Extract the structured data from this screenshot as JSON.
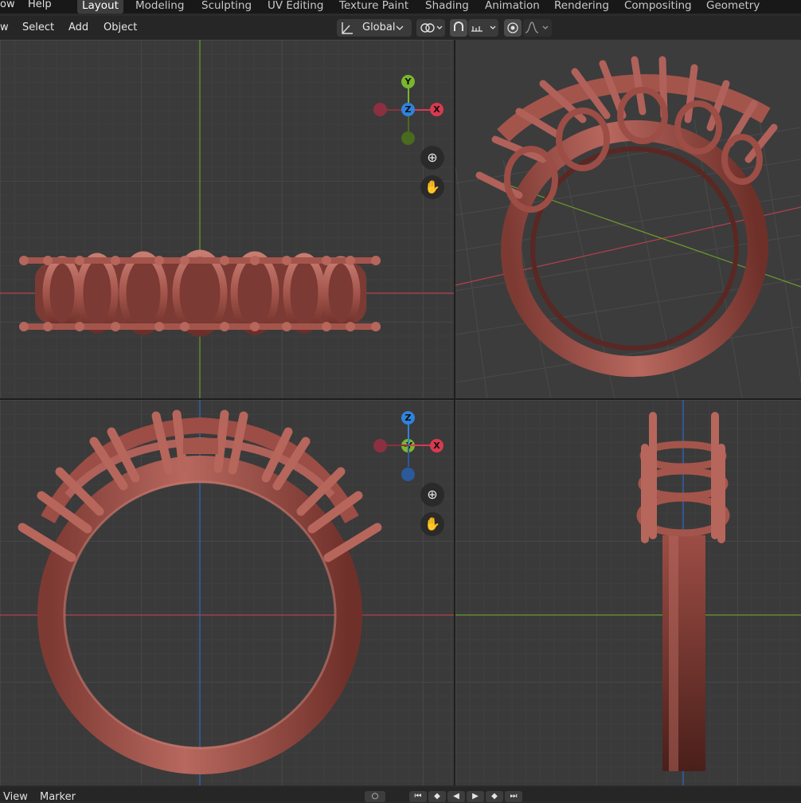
{
  "menubar": {
    "items": [
      "ow",
      "Help"
    ]
  },
  "workspaces": {
    "tabs": [
      "Layout",
      "Modeling",
      "Sculpting",
      "UV Editing",
      "Texture Paint",
      "Shading",
      "Animation",
      "Rendering",
      "Compositing",
      "Geometry Nodes"
    ],
    "active": "Layout"
  },
  "viewport_header": {
    "menu": [
      "w",
      "Select",
      "Add",
      "Object"
    ],
    "transform_orientation": "Global",
    "icons": [
      "transform-orientation-icon",
      "pivot-point-icon",
      "snap-icon",
      "snap-increment-icon",
      "proportional-editing-icon",
      "falloff-curve-icon"
    ]
  },
  "viewports": {
    "top": {
      "gizmo": {
        "up": "Y",
        "center": "Z",
        "right": "X"
      }
    },
    "perspective": {},
    "front": {
      "gizmo": {
        "up": "Z",
        "center": "-Y",
        "right": "X"
      }
    },
    "right": {}
  },
  "timeline": {
    "menu": [
      "View",
      "Marker"
    ]
  },
  "colors": {
    "x_axis": "#d83a4f",
    "y_axis": "#7ab62e",
    "z_axis": "#2f82dd",
    "ring_material": "#a4554b",
    "active_tab": "#3d3d3d"
  }
}
